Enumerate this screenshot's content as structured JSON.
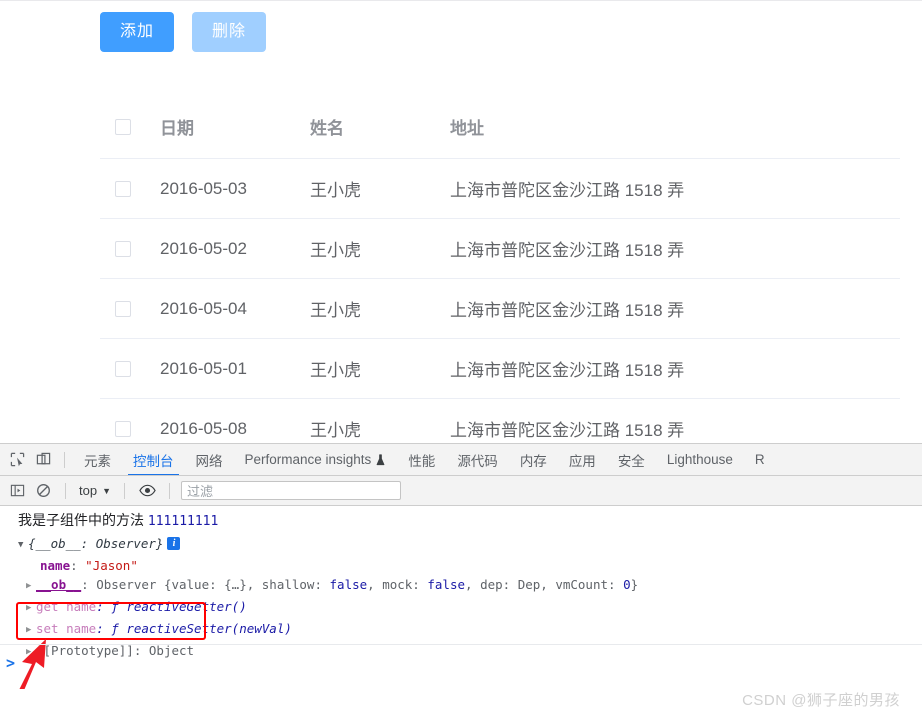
{
  "page": {
    "buttons": [
      {
        "label": "添加",
        "name": "add-button",
        "style": "primary"
      },
      {
        "label": "删除",
        "name": "delete-button",
        "style": "disabled"
      }
    ],
    "table": {
      "columns": [
        {
          "key": "check",
          "label": ""
        },
        {
          "key": "date",
          "label": "日期"
        },
        {
          "key": "name",
          "label": "姓名"
        },
        {
          "key": "address",
          "label": "地址"
        }
      ],
      "rows": [
        {
          "date": "2016-05-03",
          "name": "王小虎",
          "address": "上海市普陀区金沙江路 1518 弄"
        },
        {
          "date": "2016-05-02",
          "name": "王小虎",
          "address": "上海市普陀区金沙江路 1518 弄"
        },
        {
          "date": "2016-05-04",
          "name": "王小虎",
          "address": "上海市普陀区金沙江路 1518 弄"
        },
        {
          "date": "2016-05-01",
          "name": "王小虎",
          "address": "上海市普陀区金沙江路 1518 弄"
        },
        {
          "date": "2016-05-08",
          "name": "王小虎",
          "address": "上海市普陀区金沙江路 1518 弄"
        }
      ]
    }
  },
  "devtools": {
    "icons": {
      "inspect": "inspect-element-icon",
      "device": "device-toolbar-icon",
      "sidebar": "console-sidebar-icon",
      "clear": "clear-console-icon",
      "eye": "live-expression-icon",
      "flask": "experiment-flask-icon"
    },
    "tabs": [
      {
        "label": "元素",
        "name": "tab-elements",
        "active": false
      },
      {
        "label": "控制台",
        "name": "tab-console",
        "active": true
      },
      {
        "label": "网络",
        "name": "tab-network",
        "active": false
      },
      {
        "label": "Performance insights",
        "name": "tab-performance-insights",
        "active": false,
        "flask": true
      },
      {
        "label": "性能",
        "name": "tab-performance",
        "active": false
      },
      {
        "label": "源代码",
        "name": "tab-sources",
        "active": false
      },
      {
        "label": "内存",
        "name": "tab-memory",
        "active": false
      },
      {
        "label": "应用",
        "name": "tab-application",
        "active": false
      },
      {
        "label": "安全",
        "name": "tab-security",
        "active": false
      },
      {
        "label": "Lighthouse",
        "name": "tab-lighthouse",
        "active": false
      },
      {
        "label": "R",
        "name": "tab-recorder",
        "active": false
      }
    ],
    "toolbar": {
      "context": "top",
      "context_caret": "▼",
      "filter_placeholder": "过滤"
    },
    "console": {
      "message_text": "我是子组件中的方法",
      "message_number": "111111111",
      "object": {
        "header_caret": "▼",
        "header_text": "{__ob__: Observer}",
        "info_badge": "i",
        "prop_key": "name",
        "prop_colon": ":",
        "prop_value": "\"Jason\"",
        "lines": [
          {
            "caret": "▶",
            "key": "__ob__",
            "key_style": "link",
            "value": ": Observer {value: {…}, shallow: ",
            "tokens": [
              {
                "t": "false",
                "style": "kw"
              },
              {
                "t": ", mock: ",
                "style": "plain"
              },
              {
                "t": "false",
                "style": "kw"
              },
              {
                "t": ", dep: Dep, vmCount: ",
                "style": "plain"
              },
              {
                "t": "0",
                "style": "kw"
              },
              {
                "t": "}",
                "style": "plain"
              }
            ]
          },
          {
            "caret": "▶",
            "key": "get name",
            "key_style": "accessor",
            "value": ": ƒ reactiveGetter()"
          },
          {
            "caret": "▶",
            "key": "set name",
            "key_style": "accessor",
            "value": ": ƒ reactiveSetter(newVal)"
          },
          {
            "caret": "▶",
            "key": "[[Prototype]]",
            "key_style": "plain",
            "value": ": Object"
          }
        ]
      },
      "prompt_chevron": ">"
    }
  },
  "watermark": "CSDN @狮子座的男孩"
}
